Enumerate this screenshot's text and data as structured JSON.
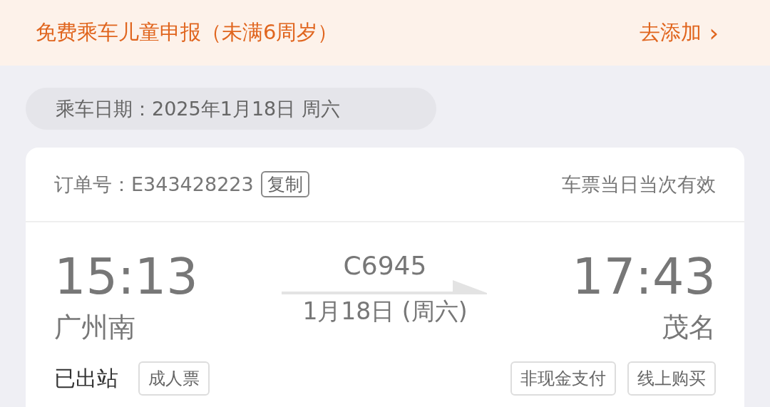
{
  "banner": {
    "title": "免费乘车儿童申报（未满6周岁）",
    "action": "去添加",
    "action_icon": "›"
  },
  "travel_date": {
    "label": "乘车日期：",
    "value": "2025年1月18日 周六"
  },
  "order": {
    "label": "订单号：",
    "number": "E343428223",
    "copy": "复制",
    "validity": "车票当日当次有效"
  },
  "trip": {
    "depart_time": "15:13",
    "depart_station": "广州南",
    "train": "C6945",
    "date": "1月18日 (周六)",
    "arrive_time": "17:43",
    "arrive_station": "茂名"
  },
  "status": "已出站",
  "left_tags": [
    "成人票"
  ],
  "right_tags": [
    "非现金支付",
    "线上购买"
  ]
}
